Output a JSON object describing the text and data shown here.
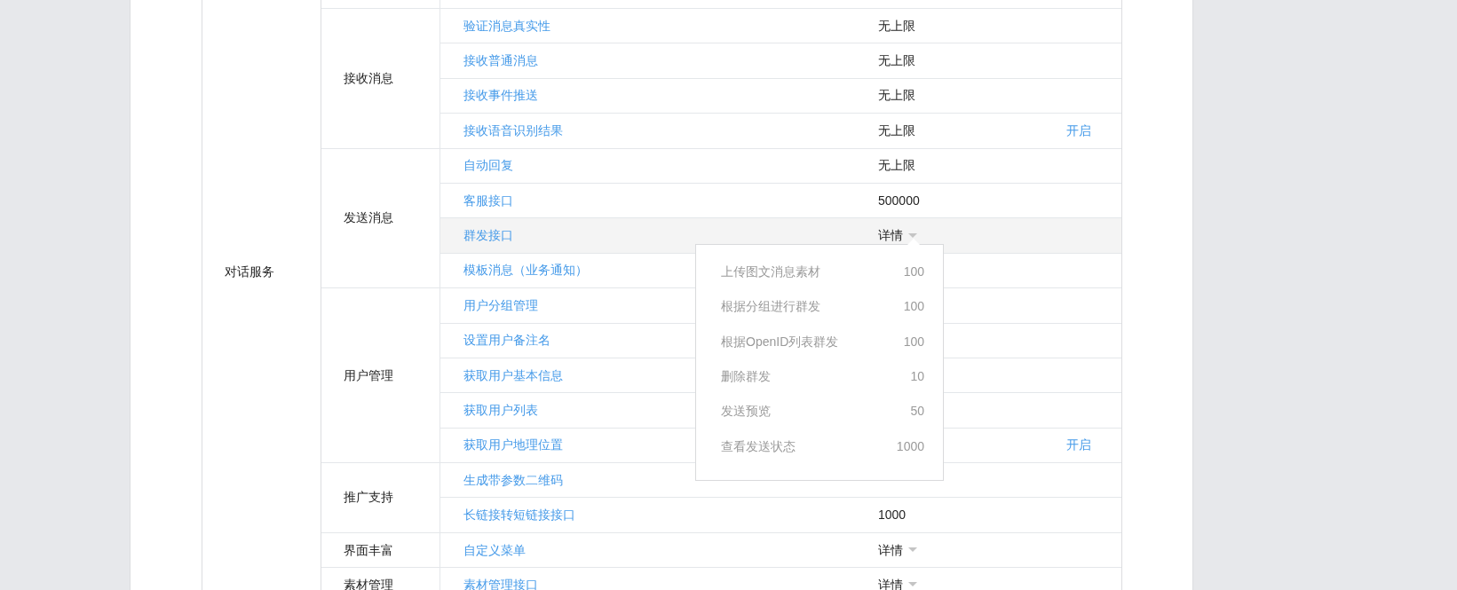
{
  "sections": [
    {
      "label": "对话服务",
      "groups": [
        {
          "label": "接收消息",
          "rows": [
            {
              "name": "验证消息真实性",
              "kind": "limit",
              "value": "无上限"
            },
            {
              "name": "接收普通消息",
              "kind": "limit",
              "value": "无上限"
            },
            {
              "name": "接收事件推送",
              "kind": "limit",
              "value": "无上限"
            },
            {
              "name": "接收语音识别结果",
              "kind": "limit",
              "value": "无上限",
              "action": "开启"
            }
          ]
        },
        {
          "label": "发送消息",
          "rows": [
            {
              "name": "自动回复",
              "kind": "limit",
              "value": "无上限"
            },
            {
              "name": "客服接口",
              "kind": "limit",
              "value": "500000"
            },
            {
              "name": "群发接口",
              "kind": "detail",
              "value": "详情",
              "expanded": true,
              "details": [
                {
                  "name": "上传图文消息素材",
                  "value": "100"
                },
                {
                  "name": "根据分组进行群发",
                  "value": "100"
                },
                {
                  "name": "根据OpenID列表群发",
                  "value": "100"
                },
                {
                  "name": "删除群发",
                  "value": "10"
                },
                {
                  "name": "发送预览",
                  "value": "50"
                },
                {
                  "name": "查看发送状态",
                  "value": "1000"
                }
              ]
            },
            {
              "name": "模板消息（业务通知）",
              "kind": "limit"
            }
          ]
        },
        {
          "label": "用户管理",
          "rows": [
            {
              "name": "用户分组管理",
              "kind": "limit"
            },
            {
              "name": "设置用户备注名",
              "kind": "limit"
            },
            {
              "name": "获取用户基本信息",
              "kind": "limit"
            },
            {
              "name": "获取用户列表",
              "kind": "limit"
            },
            {
              "name": "获取用户地理位置",
              "kind": "limit",
              "action": "开启"
            }
          ]
        },
        {
          "label": "推广支持",
          "rows": [
            {
              "name": "生成带参数二维码",
              "kind": "limit"
            },
            {
              "name": "长链接转短链接接口",
              "kind": "limit",
              "value": "1000"
            }
          ]
        },
        {
          "label": "界面丰富",
          "rows": [
            {
              "name": "自定义菜单",
              "kind": "detail",
              "value": "详情",
              "expanded": false
            }
          ]
        },
        {
          "label": "素材管理",
          "rows": [
            {
              "name": "素材管理接口",
              "kind": "detail",
              "value": "详情",
              "expanded": false
            }
          ]
        }
      ]
    }
  ]
}
